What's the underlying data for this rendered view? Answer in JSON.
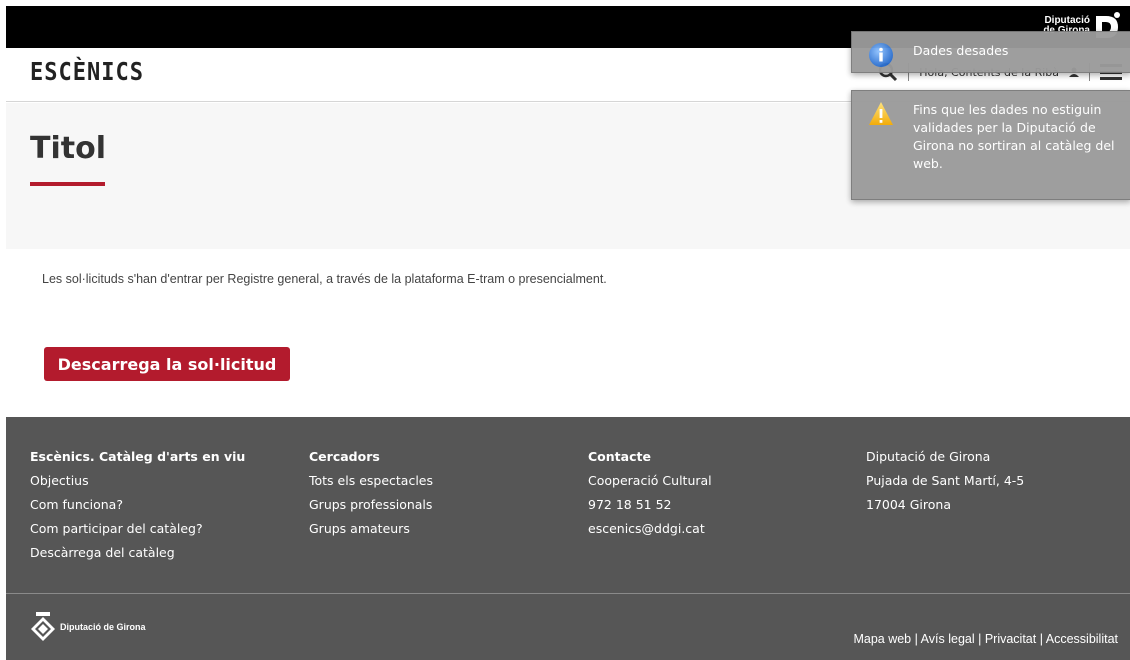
{
  "topbar": {
    "brand_line1": "Diputació",
    "brand_line2": "de Girona"
  },
  "header": {
    "logo": "ESCÈNICS",
    "greeting": "Hola, Contents de la Ribà"
  },
  "title_section": {
    "title": "Titol",
    "accent_color": "#b31b2d"
  },
  "main": {
    "info_text": "Les sol·licituds s'han d'entrar per Registre general, a través de la plataforma E-tram o presencialment.",
    "download_label": "Descarrega la sol·licitud"
  },
  "footer": {
    "col1": {
      "heading": "Escènics. Catàleg d'arts en viu",
      "links": [
        "Objectius",
        "Com funciona?",
        "Com participar del catàleg?",
        "Descàrrega del catàleg"
      ]
    },
    "col2": {
      "heading": "Cercadors",
      "links": [
        "Tots els espectacles",
        "Grups professionals",
        "Grups amateurs"
      ]
    },
    "col3": {
      "heading": "Contacte",
      "lines": [
        "Cooperació Cultural",
        "972 18 51 52",
        "escenics@ddgi.cat"
      ]
    },
    "col4": {
      "lines": [
        "Diputació de Girona",
        "Pujada de Sant Martí, 4-5",
        "17004 Girona"
      ]
    },
    "bottom_logo": "Diputació de Girona",
    "legal": {
      "sitemap": "Mapa web",
      "legal_notice": "Avís legal",
      "privacy": "Privacitat",
      "accessibility": "Accessibilitat",
      "separator": " | "
    }
  },
  "notifications": {
    "info": "Dades desades",
    "warning": "Fins que les dades no estiguin validades per la Diputació de Girona no sortiran al catàleg del web."
  }
}
